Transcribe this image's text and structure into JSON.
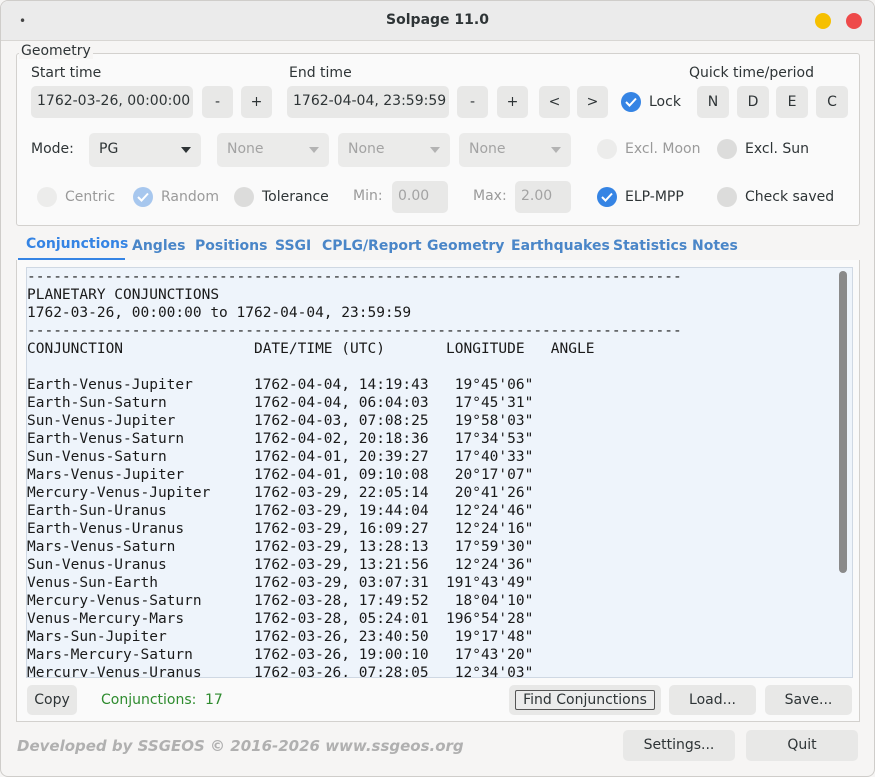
{
  "window": {
    "title": "Solpage 11.0",
    "menu_dot": "•"
  },
  "geometry": {
    "legend": "Geometry",
    "start_label": "Start time",
    "start_value": "1762-03-26, 00:00:00",
    "end_label": "End time",
    "end_value": "1762-04-04, 23:59:59",
    "minus": "-",
    "plus": "+",
    "prev": "<",
    "next": ">",
    "lock_label": "Lock",
    "quick_label": "Quick time/period",
    "quick_buttons": [
      "N",
      "D",
      "E",
      "C"
    ],
    "mode_label": "Mode:",
    "mode_value": "PG",
    "combo_none": [
      "None",
      "None",
      "None"
    ],
    "excl_moon": "Excl. Moon",
    "excl_sun": "Excl. Sun",
    "centric": "Centric",
    "random": "Random",
    "tolerance": "Tolerance",
    "min_label": "Min:",
    "min_value": "0.00",
    "max_label": "Max:",
    "max_value": "2.00",
    "elp_mpp": "ELP-MPP",
    "check_saved": "Check saved"
  },
  "tabs": [
    "Conjunctions",
    "Angles",
    "Positions",
    "SSGI",
    "CPLG/Report",
    "Geometry",
    "Earthquakes",
    "Statistics",
    "Notes"
  ],
  "output": {
    "separator": "---------------------------------------------------------------------------",
    "heading": "PLANETARY CONJUNCTIONS",
    "range": "1762-03-26, 00:00:00 to 1762-04-04, 23:59:59",
    "columns": [
      "CONJUNCTION",
      "DATE/TIME (UTC)",
      "LONGITUDE",
      "ANGLE"
    ],
    "rows": [
      [
        "Earth-Venus-Jupiter",
        "1762-04-04, 14:19:43",
        "19°45'06\""
      ],
      [
        "Earth-Sun-Saturn",
        "1762-04-04, 06:04:03",
        "17°45'31\""
      ],
      [
        "Sun-Venus-Jupiter",
        "1762-04-03, 07:08:25",
        "19°58'03\""
      ],
      [
        "Earth-Venus-Saturn",
        "1762-04-02, 20:18:36",
        "17°34'53\""
      ],
      [
        "Sun-Venus-Saturn",
        "1762-04-01, 20:39:27",
        "17°40'33\""
      ],
      [
        "Mars-Venus-Jupiter",
        "1762-04-01, 09:10:08",
        "20°17'07\""
      ],
      [
        "Mercury-Venus-Jupiter",
        "1762-03-29, 22:05:14",
        "20°41'26\""
      ],
      [
        "Earth-Sun-Uranus",
        "1762-03-29, 19:44:04",
        "12°24'46\""
      ],
      [
        "Earth-Venus-Uranus",
        "1762-03-29, 16:09:27",
        "12°24'16\""
      ],
      [
        "Mars-Venus-Saturn",
        "1762-03-29, 13:28:13",
        "17°59'30\""
      ],
      [
        "Sun-Venus-Uranus",
        "1762-03-29, 13:21:56",
        "12°24'36\""
      ],
      [
        "Venus-Sun-Earth",
        "1762-03-29, 03:07:31",
        "191°43'49\""
      ],
      [
        "Mercury-Venus-Saturn",
        "1762-03-28, 17:49:52",
        "18°04'10\""
      ],
      [
        "Venus-Mercury-Mars",
        "1762-03-28, 05:24:01",
        "196°54'28\""
      ],
      [
        "Mars-Sun-Jupiter",
        "1762-03-26, 23:40:50",
        "19°17'48\""
      ],
      [
        "Mars-Mercury-Saturn",
        "1762-03-26, 19:00:10",
        "17°43'20\""
      ],
      [
        "Mercury-Venus-Uranus",
        "1762-03-26, 07:28:05",
        "12°34'03\""
      ]
    ]
  },
  "bottom": {
    "copy": "Copy",
    "count_label": "Conjunctions:",
    "count_value": "17",
    "find": "Find Conjunctions",
    "load": "Load...",
    "save": "Save...",
    "settings": "Settings...",
    "quit": "Quit",
    "footer": "Developed by SSGEOS © 2016-2026 www.ssgeos.org"
  }
}
